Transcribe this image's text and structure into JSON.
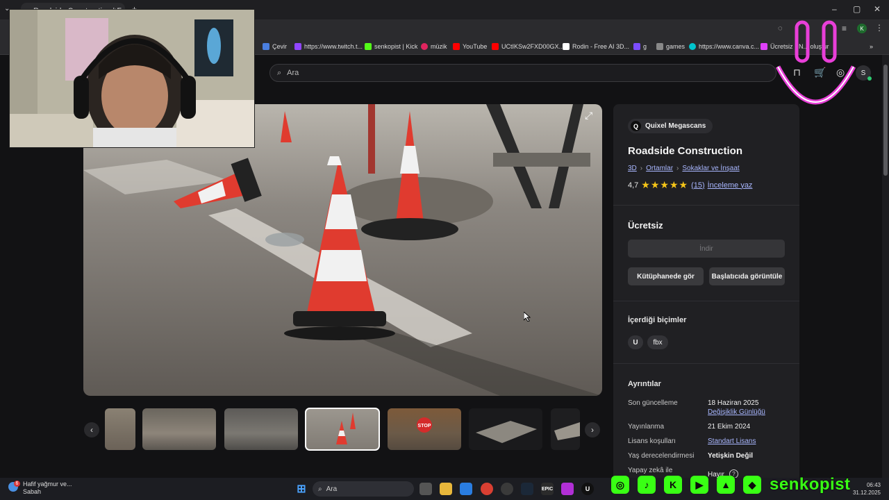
{
  "browser": {
    "tab_title": "Roadside Construction | Fab",
    "tab_close": "×",
    "window_controls": [
      "–",
      "▢",
      "✕"
    ]
  },
  "bookmarks": [
    {
      "label": "Çevir",
      "color": "#4a7fe0"
    },
    {
      "label": "https://www.twitch.t...",
      "color": "#9146ff"
    },
    {
      "label": "senkopist | Kick",
      "color": "#53fc18"
    },
    {
      "label": "müzik",
      "color": "#e0245e"
    },
    {
      "label": "YouTube",
      "color": "#ff0000"
    },
    {
      "label": "UCtIKSw2FXD00GX...",
      "color": "#ff0000"
    },
    {
      "label": "Rodin - Free AI 3D...",
      "color": "#ffffff"
    },
    {
      "label": "g",
      "color": "#7c4dff"
    },
    {
      "label": "games",
      "color": "#888888"
    },
    {
      "label": "https://www.canva.c...",
      "color": "#00c4cc"
    },
    {
      "label": "Ücretsiz PN... oluştur",
      "color": "#e040fb"
    }
  ],
  "site": {
    "search_placeholder": "Ara",
    "avatar_letter": "S"
  },
  "product": {
    "seller": "Quixel Megascans",
    "seller_logo_letter": "Q",
    "title": "Roadside Construction",
    "breadcrumb": [
      "3D",
      "Ortamlar",
      "Sokaklar ve İnşaat"
    ],
    "rating_value": "4,7",
    "rating_stars": 4.7,
    "rating_stars_glyphs": "★★★★★",
    "rating_count": "(15)",
    "review_link": "İnceleme yaz",
    "price": "Ücretsiz",
    "download_button": "İndir",
    "library_button": "Kütüphanede gör",
    "launcher_button": "Başlatıcıda görüntüle",
    "formats_heading": "İçerdiği biçimler",
    "formats": [
      "U",
      "fbx"
    ],
    "details_heading": "Ayrıntılar",
    "details": [
      {
        "label": "Son güncelleme",
        "value": "18 Haziran 2025",
        "link": "Değişiklik Günlüğü"
      },
      {
        "label": "Yayınlanma",
        "value": "21 Ekim 2024"
      },
      {
        "label": "Lisans koşulları",
        "value": "Standart Lisans"
      },
      {
        "label": "Yaş derecelendirmesi",
        "value": "Yetişkin Değil"
      },
      {
        "label": "Yapay zekâ ile",
        "value": "Hayır"
      }
    ]
  },
  "gallery": {
    "thumbnail_count": 7,
    "selected_index": 3
  },
  "taskbar": {
    "weather_badge": "6",
    "weather_text": "Hafif yağmur ve...",
    "weather_sub": "Sabah",
    "search_placeholder": "Ara",
    "time": "06:43",
    "date": "31.12.2025"
  },
  "overlay": {
    "handle": "senkopist"
  },
  "colors": {
    "accent_link": "#a9b7ff",
    "star": "#f5c518",
    "brand_green": "#39ff14",
    "overlay_magenta": "#e83fd8"
  }
}
